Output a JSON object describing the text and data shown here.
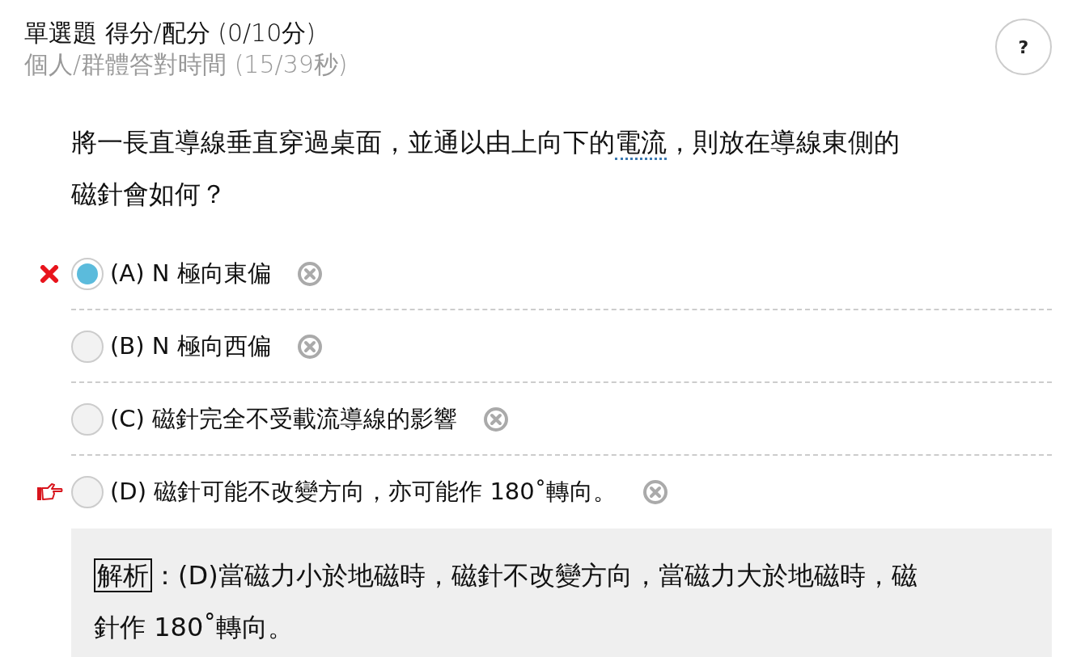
{
  "header": {
    "title": "單選題 得分/配分 (0/10分)",
    "subtitle": "個人/群體答對時間 (15/39秒)"
  },
  "help_button": {
    "label": "?"
  },
  "question": {
    "before": "將一長直導線垂直穿過桌面，並通以由上向下的",
    "term": "電流",
    "after": "，則放在導線東側的磁針會如何？"
  },
  "options": [
    {
      "label": "(A)",
      "text": "N 極向東偏",
      "selected": true,
      "wrong": true,
      "correct_answer": false
    },
    {
      "label": "(B)",
      "text": "N 極向西偏",
      "selected": false,
      "wrong": false,
      "correct_answer": false
    },
    {
      "label": "(C)",
      "text": "磁針完全不受載流導線的影響",
      "selected": false,
      "wrong": false,
      "correct_answer": false
    },
    {
      "label": "(D)",
      "text": "磁針可能不改變方向，亦可能作 180˚轉向。",
      "selected": false,
      "wrong": false,
      "correct_answer": true
    }
  ],
  "explanation": {
    "label": "解析",
    "text": "：(D)當磁力小於地磁時，磁針不改變方向，當磁力大於地磁時，磁針作 180˚轉向。"
  }
}
